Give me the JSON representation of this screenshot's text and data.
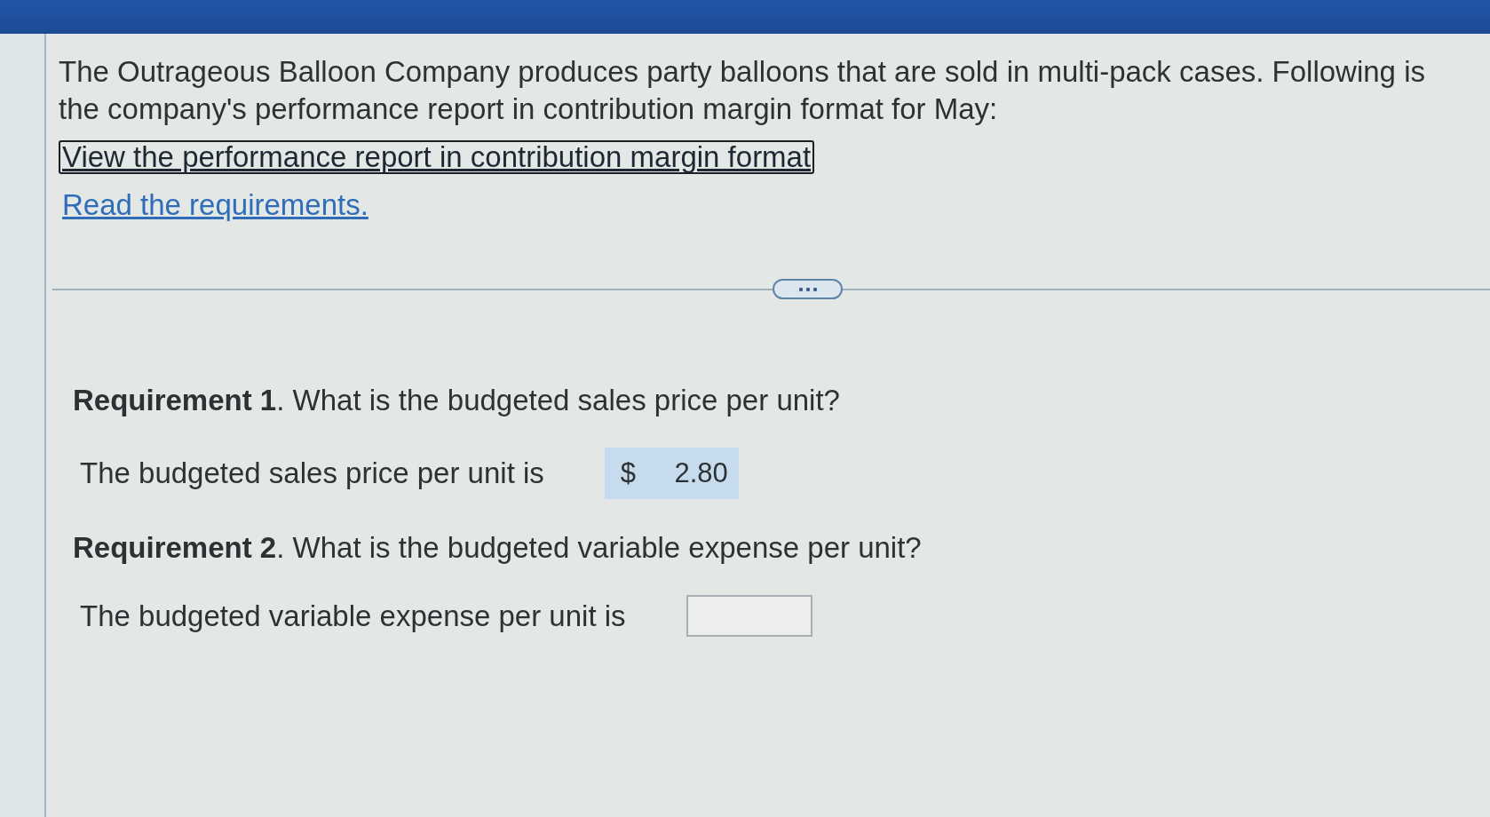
{
  "intro": "The Outrageous Balloon Company produces party balloons that are sold in multi-pack cases. Following is the company's performance report in contribution margin format for May:",
  "links": [
    {
      "text": "View the performance report in contribution margin format",
      "focused": true
    },
    {
      "text": "Read the requirements.",
      "focused": false
    }
  ],
  "requirements": [
    {
      "heading": "**Requirement 1**. What is the budgeted sales price per unit?",
      "prompt": "The budgeted sales price per unit is",
      "answer": {
        "currency": "$",
        "value": "2.80",
        "highlighted": true
      }
    },
    {
      "heading": "**Requirement 2**. What is the budgeted variable expense per unit?",
      "prompt": "The budgeted variable expense per unit is",
      "answer": {
        "highlighted": false
      }
    }
  ]
}
